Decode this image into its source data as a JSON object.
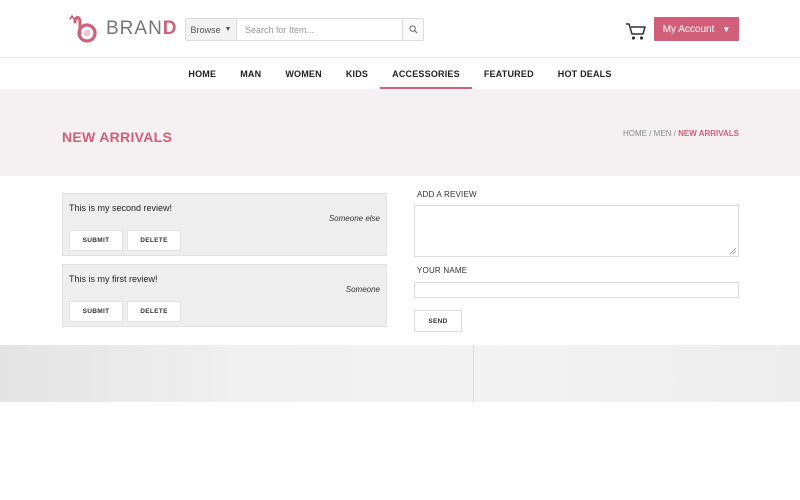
{
  "brand": {
    "name_part1": "BRAN",
    "name_part2": "D",
    "icon": "brand-logo-mark",
    "accent_color": "#d0607a"
  },
  "search": {
    "browse_label": "Browse",
    "placeholder": "Search for Item...",
    "icon": "search-icon"
  },
  "header": {
    "cart_icon": "cart-icon",
    "account_label": "My Account"
  },
  "nav": {
    "items": [
      {
        "label": "HOME"
      },
      {
        "label": "MAN"
      },
      {
        "label": "WOMEN"
      },
      {
        "label": "KIDS"
      },
      {
        "label": "ACCESSORIES",
        "active": true
      },
      {
        "label": "FEATURED"
      },
      {
        "label": "HOT DEALS"
      }
    ]
  },
  "banner": {
    "title": "NEW ARRIVALS",
    "breadcrumb": {
      "home": "HOME",
      "sep1": " / ",
      "men": "MEN",
      "sep2": " / ",
      "current": "NEW ARRIVALS"
    }
  },
  "reviews": [
    {
      "text": "This is my second review!",
      "author": "Someone else",
      "submit_label": "SUBMIT",
      "delete_label": "DELETE"
    },
    {
      "text": "This is my first review!",
      "author": "Someone",
      "submit_label": "SUBMIT",
      "delete_label": "DELETE"
    }
  ],
  "form": {
    "review_label": "ADD A REVIEW",
    "review_value": "",
    "name_label": "YOUR NAME",
    "name_value": "",
    "send_label": "SEND"
  }
}
